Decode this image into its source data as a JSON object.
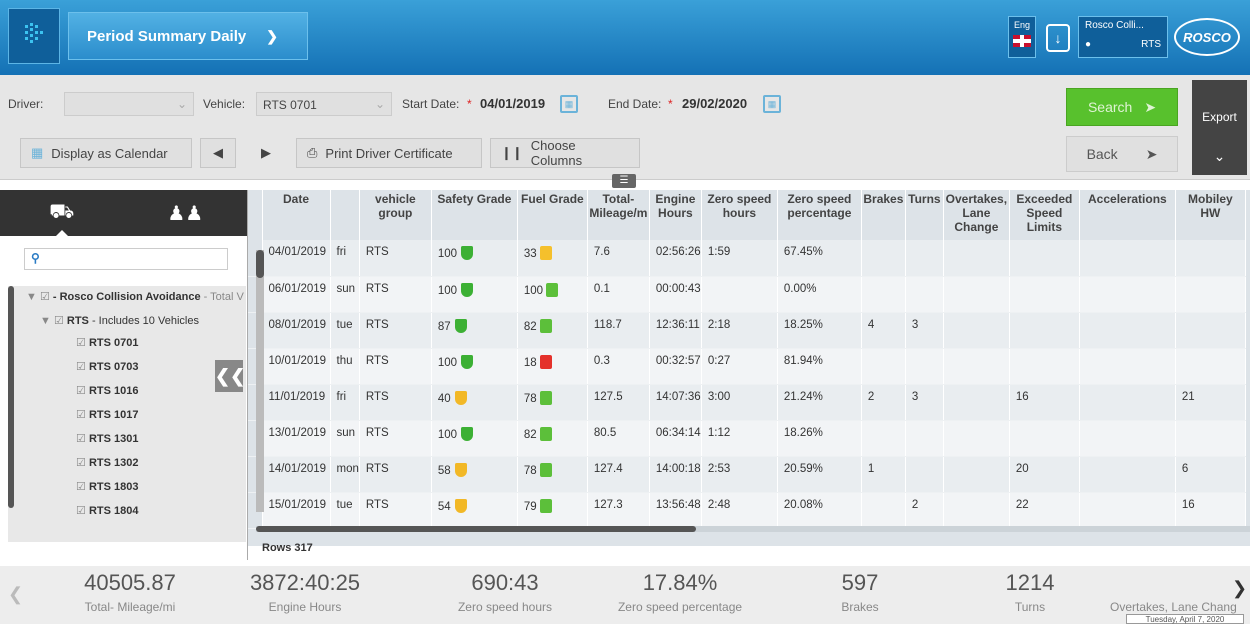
{
  "header": {
    "title": "Period Summary Daily",
    "lang": "Eng",
    "user_name": "Rosco Colli...",
    "user_org": "RTS",
    "brand": "ROSCO"
  },
  "filters": {
    "driver_label": "Driver:",
    "vehicle_label": "Vehicle:",
    "vehicle_value": "RTS 0701",
    "start_label": "Start Date:",
    "start_value": "04/01/2019",
    "end_label": "End Date:",
    "end_value": "29/02/2020",
    "required_mark": "*"
  },
  "toolbar": {
    "calendar_label": "Display as Calendar",
    "print_label": "Print Driver Certificate",
    "columns_label": "Choose Columns",
    "search_label": "Search",
    "back_label": "Back",
    "export_label": "Export"
  },
  "tree": {
    "root": "- Rosco Collision Avoidance",
    "root_tail": "- Total V",
    "group": "RTS",
    "group_tail": "- Includes 10 Vehicles",
    "vehicles": [
      "RTS 0701",
      "RTS 0703",
      "RTS 1016",
      "RTS 1017",
      "RTS 1301",
      "RTS 1302",
      "RTS 1803",
      "RTS 1804"
    ]
  },
  "table": {
    "headers": [
      "Date",
      "",
      "vehicle group",
      "Safety Grade",
      "Fuel Grade",
      "Total-\nMileage/m",
      "Engine\nHours",
      "Zero speed\nhours",
      "Zero speed\npercentage",
      "Brakes",
      "Turns",
      "Overtakes,\nLane\nChange",
      "Exceeded\nSpeed\nLimits",
      "Accelerations",
      "Mobiley\nHW"
    ],
    "rows": [
      [
        "04/01/2019",
        "fri",
        "RTS",
        "100",
        "33",
        "7.6",
        "02:56:26",
        "1:59",
        "67.45%",
        "",
        "",
        "",
        "",
        "",
        ""
      ],
      [
        "06/01/2019",
        "sun",
        "RTS",
        "100",
        "100",
        "0.1",
        "00:00:43",
        "",
        "0.00%",
        "",
        "",
        "",
        "",
        "",
        ""
      ],
      [
        "08/01/2019",
        "tue",
        "RTS",
        "87",
        "82",
        "118.7",
        "12:36:11",
        "2:18",
        "18.25%",
        "4",
        "3",
        "",
        "",
        "",
        ""
      ],
      [
        "10/01/2019",
        "thu",
        "RTS",
        "100",
        "18",
        "0.3",
        "00:32:57",
        "0:27",
        "81.94%",
        "",
        "",
        "",
        "",
        "",
        ""
      ],
      [
        "11/01/2019",
        "fri",
        "RTS",
        "40",
        "78",
        "127.5",
        "14:07:36",
        "3:00",
        "21.24%",
        "2",
        "3",
        "",
        "16",
        "",
        "21"
      ],
      [
        "13/01/2019",
        "sun",
        "RTS",
        "100",
        "82",
        "80.5",
        "06:34:14",
        "1:12",
        "18.26%",
        "",
        "",
        "",
        "",
        "",
        ""
      ],
      [
        "14/01/2019",
        "mon",
        "RTS",
        "58",
        "78",
        "127.4",
        "14:00:18",
        "2:53",
        "20.59%",
        "1",
        "",
        "",
        "20",
        "",
        "6"
      ],
      [
        "15/01/2019",
        "tue",
        "RTS",
        "54",
        "79",
        "127.3",
        "13:56:48",
        "2:48",
        "20.08%",
        "",
        "2",
        "",
        "22",
        "",
        "16"
      ]
    ],
    "rows_label": "Rows 317"
  },
  "summary": [
    {
      "value": "40505.87",
      "label": "Total- Mileage/mi"
    },
    {
      "value": "3872:40:25",
      "label": "Engine Hours"
    },
    {
      "value": "690:43",
      "label": "Zero speed hours"
    },
    {
      "value": "17.84%",
      "label": "Zero speed percentage"
    },
    {
      "value": "597",
      "label": "Brakes"
    },
    {
      "value": "1214",
      "label": "Turns"
    },
    {
      "value": "",
      "label": "Overtakes, Lane Chang"
    }
  ],
  "tooltip": "Tuesday, April 7, 2020",
  "colors": {
    "safety_green": "#3cb034",
    "safety_yellow": "#f2b826",
    "fuel_green": "#5cbf3a",
    "fuel_yellow": "#f5c02c",
    "fuel_red": "#e4312b"
  }
}
